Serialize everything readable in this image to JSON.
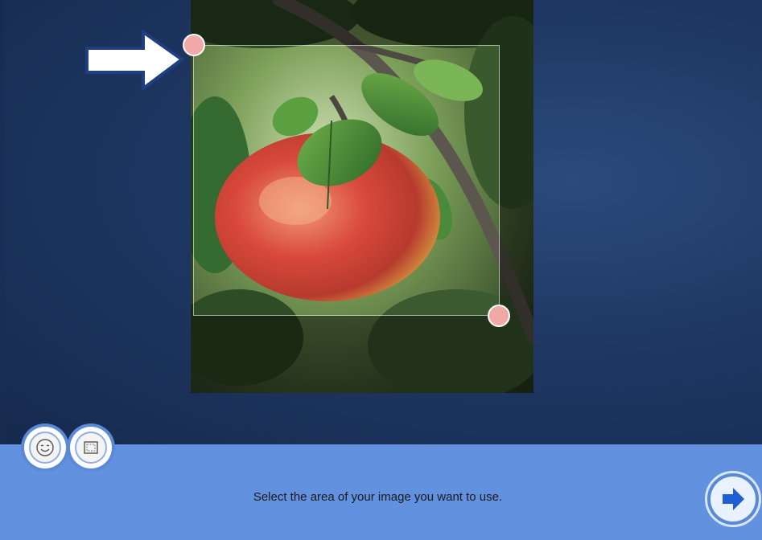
{
  "editor": {
    "instruction": "Select the area of your image you want to use."
  },
  "tools": [
    {
      "name": "face-tool",
      "icon": "smiley-face-icon"
    },
    {
      "name": "crop-tool",
      "icon": "crop-frame-icon"
    }
  ],
  "navigation": {
    "next_icon": "arrow-right-icon"
  },
  "photo": {
    "subject_icon": "apple-photo"
  },
  "colors": {
    "background": "#1d3560",
    "toolbar": "#6291e0",
    "handle": "#f1a8a8",
    "next_arrow": "#1f5fd6"
  }
}
